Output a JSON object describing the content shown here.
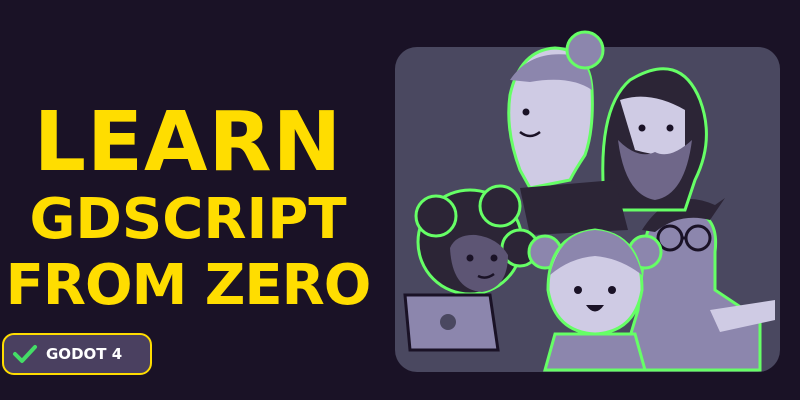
{
  "headline": {
    "line1": "LEARN",
    "line2": "GDSCRIPT",
    "line3": "FROM ZERO"
  },
  "badge": {
    "label": "GODOT 4",
    "icon": "checkmark-icon"
  },
  "colors": {
    "background": "#1a1226",
    "headline": "#ffdd00",
    "badge_border": "#ffdd00",
    "badge_fill": "#4a4060",
    "check": "#44dd66",
    "outline_glow": "#66ff66",
    "panel": "#4a4860"
  }
}
